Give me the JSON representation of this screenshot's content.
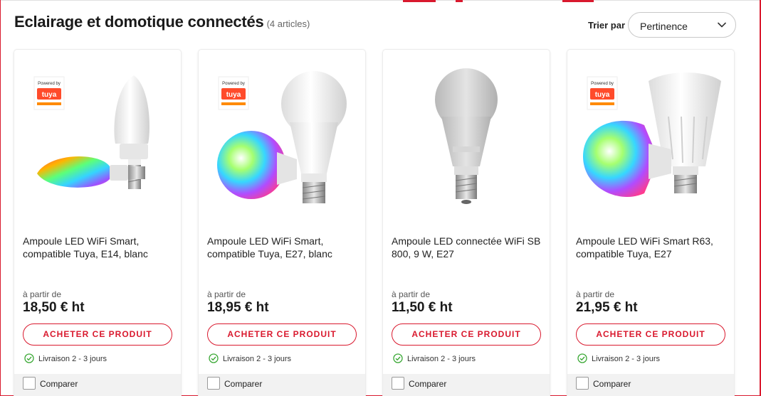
{
  "header": {
    "title": "Eclairage et domotique connectés",
    "count": "(4 articles)",
    "sort_label": "Trier par",
    "sort_value": "Pertinence"
  },
  "colors": {
    "accent": "#d9192e",
    "delivery_ok": "#3aa835"
  },
  "products": [
    {
      "name": "Ampoule LED WiFi Smart, compatible Tuya, E14, blanc",
      "from": "à partir de",
      "price": "18,50 € ht",
      "buy_label": "ACHETER CE PRODUIT",
      "delivery": "Livraison 2 - 3 jours",
      "compare_label": "Comparer",
      "badge_top": "Powered by",
      "badge_brand": "tuya"
    },
    {
      "name": "Ampoule LED WiFi Smart, compatible Tuya, E27, blanc",
      "from": "à partir de",
      "price": "18,95 € ht",
      "buy_label": "ACHETER CE PRODUIT",
      "delivery": "Livraison 2 - 3 jours",
      "compare_label": "Comparer",
      "badge_top": "Powered by",
      "badge_brand": "tuya"
    },
    {
      "name": "Ampoule LED connectée WiFi SB 800, 9 W, E27",
      "from": "à partir de",
      "price": "11,50 € ht",
      "buy_label": "ACHETER CE PRODUIT",
      "delivery": "Livraison 2 - 3 jours",
      "compare_label": "Comparer"
    },
    {
      "name": "Ampoule LED WiFi Smart R63, compatible Tuya, E27",
      "from": "à partir de",
      "price": "21,95 € ht",
      "buy_label": "ACHETER CE PRODUIT",
      "delivery": "Livraison 2 - 3 jours",
      "compare_label": "Comparer",
      "badge_top": "Powered by",
      "badge_brand": "tuya"
    }
  ]
}
